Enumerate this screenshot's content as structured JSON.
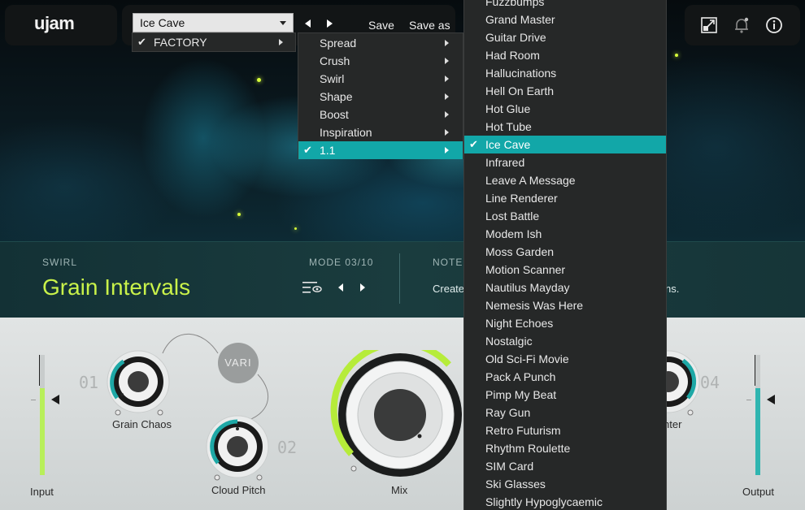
{
  "app": {
    "logo": "ujam",
    "preset_select": "Ice Cave",
    "save_label": "Save",
    "save_as_label": "Save as"
  },
  "menu_bank": {
    "items": [
      {
        "label": "FACTORY",
        "checked": true
      }
    ]
  },
  "menu_category": {
    "items": [
      {
        "label": "Spread",
        "checked": false
      },
      {
        "label": "Crush",
        "checked": false
      },
      {
        "label": "Swirl",
        "checked": false
      },
      {
        "label": "Shape",
        "checked": false
      },
      {
        "label": "Boost",
        "checked": false
      },
      {
        "label": "Inspiration",
        "checked": false
      },
      {
        "label": "1.1",
        "checked": true
      }
    ]
  },
  "menu_presets": {
    "items": [
      "Fuzzbumps",
      "Grand Master",
      "Guitar Drive",
      "Had Room",
      "Hallucinations",
      "Hell On Earth",
      "Hot Glue",
      "Hot Tube",
      "Ice Cave",
      "Infrared",
      "Leave A Message",
      "Line Renderer",
      "Lost Battle",
      "Modem Ish",
      "Moss Garden",
      "Motion Scanner",
      "Nautilus Mayday",
      "Nemesis Was Here",
      "Night Echoes",
      "Nostalgic",
      "Old Sci-Fi Movie",
      "Pack A Punch",
      "Pimp My Beat",
      "Ray Gun",
      "Retro Futurism",
      "Rhythm Roulette",
      "SIM Card",
      "Ski Glasses",
      "Slightly Hypoglycaemic"
    ],
    "selected": "Ice Cave"
  },
  "info": {
    "category": "SWIRL",
    "preset_name": "Grain Intervals",
    "mode": "MODE 03/10",
    "notes_label": "NOTES",
    "notes_text": "Create",
    "notes_tail": "ns."
  },
  "controls": {
    "input_label": "Input",
    "output_label": "Output",
    "knob1_label": "Grain Chaos",
    "knob1_num": "01",
    "knob2_label": "Cloud Pitch",
    "knob2_num": "02",
    "knob4_label": "hter",
    "knob4_num": "04",
    "mix_label": "Mix",
    "vari_label": "VARI",
    "input_level": 0.72,
    "output_level": 0.72
  },
  "colors": {
    "accent_teal": "#12a7a8",
    "accent_green": "#c9f24a",
    "meter_green": "#b8ef5a",
    "meter_teal": "#2fb5b0"
  }
}
